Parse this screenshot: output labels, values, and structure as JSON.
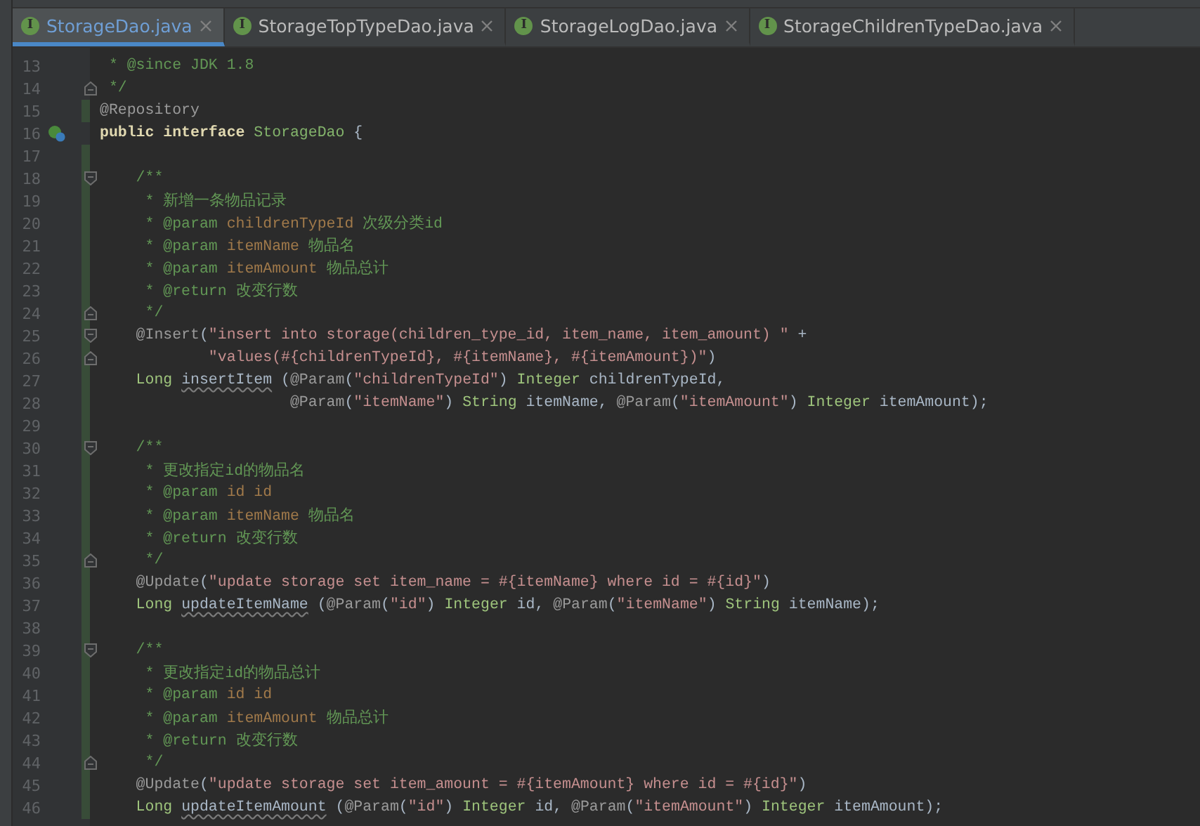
{
  "tabs": [
    {
      "icon_letter": "I",
      "label": "StorageDao.java",
      "selected": true
    },
    {
      "icon_letter": "I",
      "label": "StorageTopTypeDao.java",
      "selected": false
    },
    {
      "icon_letter": "I",
      "label": "StorageLogDao.java",
      "selected": false
    },
    {
      "icon_letter": "I",
      "label": "StorageChildrenTypeDao.java",
      "selected": false
    }
  ],
  "lines": [
    {
      "number": "13",
      "changed": false,
      "tokens": [
        {
          "kind": "comment",
          "text": " * @since JDK 1.8"
        }
      ]
    },
    {
      "number": "14",
      "changed": false,
      "fold_end": true,
      "tokens": [
        {
          "kind": "comment",
          "text": " */"
        }
      ]
    },
    {
      "number": "15",
      "changed": true,
      "tokens": [
        {
          "kind": "annotation",
          "text": "@Repository"
        }
      ]
    },
    {
      "number": "16",
      "changed": false,
      "implements": true,
      "tokens": [
        {
          "kind": "keyword",
          "text": "public interface "
        },
        {
          "kind": "classname",
          "text": "StorageDao"
        },
        {
          "kind": "plain",
          "text": " {"
        }
      ]
    },
    {
      "number": "17",
      "changed": true
    },
    {
      "number": "18",
      "changed": true,
      "fold_start": true,
      "tokens": [
        {
          "kind": "comment",
          "text": "    /**"
        }
      ]
    },
    {
      "number": "19",
      "changed": true,
      "tokens": [
        {
          "kind": "comment",
          "text": "     * 新增一条物品记录"
        }
      ]
    },
    {
      "number": "20",
      "changed": true,
      "tokens": [
        {
          "kind": "comment",
          "text": "     * @param "
        },
        {
          "kind": "param",
          "text": "childrenTypeId"
        },
        {
          "kind": "comment",
          "text": " 次级分类id"
        }
      ]
    },
    {
      "number": "21",
      "changed": true,
      "tokens": [
        {
          "kind": "comment",
          "text": "     * @param "
        },
        {
          "kind": "param",
          "text": "itemName"
        },
        {
          "kind": "comment",
          "text": " 物品名"
        }
      ]
    },
    {
      "number": "22",
      "changed": true,
      "tokens": [
        {
          "kind": "comment",
          "text": "     * @param "
        },
        {
          "kind": "param",
          "text": "itemAmount"
        },
        {
          "kind": "comment",
          "text": " 物品总计"
        }
      ]
    },
    {
      "number": "23",
      "changed": true,
      "tokens": [
        {
          "kind": "comment",
          "text": "     * @return 改变行数"
        }
      ]
    },
    {
      "number": "24",
      "changed": true,
      "fold_end": true,
      "tokens": [
        {
          "kind": "comment",
          "text": "     */"
        }
      ]
    },
    {
      "number": "25",
      "changed": true,
      "fold_start": true,
      "tokens": [
        {
          "kind": "annotation",
          "text": "    @Insert"
        },
        {
          "kind": "plain",
          "text": "("
        },
        {
          "kind": "string",
          "text": "\"insert into storage(children_type_id, item_name, item_amount) \""
        },
        {
          "kind": "plain",
          "text": " +"
        }
      ]
    },
    {
      "number": "26",
      "changed": true,
      "fold_end": true,
      "tokens": [
        {
          "kind": "string",
          "text": "            \"values(#{childrenTypeId}, #{itemName}, #{itemAmount})\""
        },
        {
          "kind": "plain",
          "text": ")"
        }
      ]
    },
    {
      "number": "27",
      "changed": true,
      "tokens": [
        {
          "kind": "type",
          "text": "    Long "
        },
        {
          "kind": "warning",
          "text": "insertItem"
        },
        {
          "kind": "plain",
          "text": " ("
        },
        {
          "kind": "annotation",
          "text": "@Param"
        },
        {
          "kind": "plain",
          "text": "("
        },
        {
          "kind": "string",
          "text": "\"childrenTypeId\""
        },
        {
          "kind": "plain",
          "text": ") "
        },
        {
          "kind": "type",
          "text": "Integer"
        },
        {
          "kind": "plain",
          "text": " childrenTypeId,"
        }
      ]
    },
    {
      "number": "28",
      "changed": true,
      "tokens": [
        {
          "kind": "annotation",
          "text": "                     @Param"
        },
        {
          "kind": "plain",
          "text": "("
        },
        {
          "kind": "string",
          "text": "\"itemName\""
        },
        {
          "kind": "plain",
          "text": ") "
        },
        {
          "kind": "type",
          "text": "String"
        },
        {
          "kind": "plain",
          "text": " itemName, "
        },
        {
          "kind": "annotation",
          "text": "@Param"
        },
        {
          "kind": "plain",
          "text": "("
        },
        {
          "kind": "string",
          "text": "\"itemAmount\""
        },
        {
          "kind": "plain",
          "text": ") "
        },
        {
          "kind": "type",
          "text": "Integer"
        },
        {
          "kind": "plain",
          "text": " itemAmount);"
        }
      ]
    },
    {
      "number": "29",
      "changed": true
    },
    {
      "number": "30",
      "changed": true,
      "fold_start": true,
      "tokens": [
        {
          "kind": "comment",
          "text": "    /**"
        }
      ]
    },
    {
      "number": "31",
      "changed": true,
      "tokens": [
        {
          "kind": "comment",
          "text": "     * 更改指定id的物品名"
        }
      ]
    },
    {
      "number": "32",
      "changed": true,
      "tokens": [
        {
          "kind": "comment",
          "text": "     * @param "
        },
        {
          "kind": "param",
          "text": "id id"
        }
      ]
    },
    {
      "number": "33",
      "changed": true,
      "tokens": [
        {
          "kind": "comment",
          "text": "     * @param "
        },
        {
          "kind": "param",
          "text": "itemName"
        },
        {
          "kind": "comment",
          "text": " 物品名"
        }
      ]
    },
    {
      "number": "34",
      "changed": true,
      "tokens": [
        {
          "kind": "comment",
          "text": "     * @return 改变行数"
        }
      ]
    },
    {
      "number": "35",
      "changed": true,
      "fold_end": true,
      "tokens": [
        {
          "kind": "comment",
          "text": "     */"
        }
      ]
    },
    {
      "number": "36",
      "changed": true,
      "tokens": [
        {
          "kind": "annotation",
          "text": "    @Update"
        },
        {
          "kind": "plain",
          "text": "("
        },
        {
          "kind": "string",
          "text": "\"update storage set item_name = #{itemName} where id = #{id}\""
        },
        {
          "kind": "plain",
          "text": ")"
        }
      ]
    },
    {
      "number": "37",
      "changed": true,
      "tokens": [
        {
          "kind": "type",
          "text": "    Long "
        },
        {
          "kind": "warning",
          "text": "updateItemName"
        },
        {
          "kind": "plain",
          "text": " ("
        },
        {
          "kind": "annotation",
          "text": "@Param"
        },
        {
          "kind": "plain",
          "text": "("
        },
        {
          "kind": "string",
          "text": "\"id\""
        },
        {
          "kind": "plain",
          "text": ") "
        },
        {
          "kind": "type",
          "text": "Integer"
        },
        {
          "kind": "plain",
          "text": " id, "
        },
        {
          "kind": "annotation",
          "text": "@Param"
        },
        {
          "kind": "plain",
          "text": "("
        },
        {
          "kind": "string",
          "text": "\"itemName\""
        },
        {
          "kind": "plain",
          "text": ") "
        },
        {
          "kind": "type",
          "text": "String"
        },
        {
          "kind": "plain",
          "text": " itemName);"
        }
      ]
    },
    {
      "number": "38",
      "changed": true
    },
    {
      "number": "39",
      "changed": true,
      "fold_start": true,
      "tokens": [
        {
          "kind": "comment",
          "text": "    /**"
        }
      ]
    },
    {
      "number": "40",
      "changed": true,
      "tokens": [
        {
          "kind": "comment",
          "text": "     * 更改指定id的物品总计"
        }
      ]
    },
    {
      "number": "41",
      "changed": true,
      "tokens": [
        {
          "kind": "comment",
          "text": "     * @param "
        },
        {
          "kind": "param",
          "text": "id id"
        }
      ]
    },
    {
      "number": "42",
      "changed": true,
      "tokens": [
        {
          "kind": "comment",
          "text": "     * @param "
        },
        {
          "kind": "param",
          "text": "itemAmount"
        },
        {
          "kind": "comment",
          "text": " 物品总计"
        }
      ]
    },
    {
      "number": "43",
      "changed": true,
      "tokens": [
        {
          "kind": "comment",
          "text": "     * @return 改变行数"
        }
      ]
    },
    {
      "number": "44",
      "changed": true,
      "fold_end": true,
      "tokens": [
        {
          "kind": "comment",
          "text": "     */"
        }
      ]
    },
    {
      "number": "45",
      "changed": true,
      "tokens": [
        {
          "kind": "annotation",
          "text": "    @Update"
        },
        {
          "kind": "plain",
          "text": "("
        },
        {
          "kind": "string",
          "text": "\"update storage set item_amount = #{itemAmount} where id = #{id}\""
        },
        {
          "kind": "plain",
          "text": ")"
        }
      ]
    },
    {
      "number": "46",
      "changed": true,
      "tokens": [
        {
          "kind": "type",
          "text": "    Long "
        },
        {
          "kind": "warning",
          "text": "updateItemAmount"
        },
        {
          "kind": "plain",
          "text": " ("
        },
        {
          "kind": "annotation",
          "text": "@Param"
        },
        {
          "kind": "plain",
          "text": "("
        },
        {
          "kind": "string",
          "text": "\"id\""
        },
        {
          "kind": "plain",
          "text": ") "
        },
        {
          "kind": "type",
          "text": "Integer"
        },
        {
          "kind": "plain",
          "text": " id, "
        },
        {
          "kind": "annotation",
          "text": "@Param"
        },
        {
          "kind": "plain",
          "text": "("
        },
        {
          "kind": "string",
          "text": "\"itemAmount\""
        },
        {
          "kind": "plain",
          "text": ") "
        },
        {
          "kind": "type",
          "text": "Integer"
        },
        {
          "kind": "plain",
          "text": " itemAmount);"
        }
      ]
    }
  ]
}
